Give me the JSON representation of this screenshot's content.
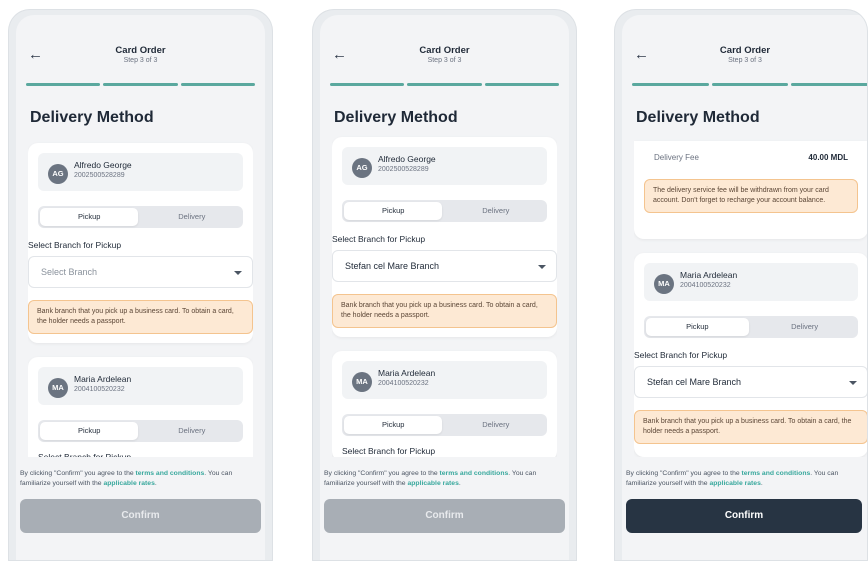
{
  "screens": [
    {
      "header": {
        "back_icon": "arrow-left-icon",
        "title": "Card Order",
        "step": "Step 3 of 3"
      },
      "section_title": "Delivery Method",
      "cards": [
        {
          "avatar": "AG",
          "name": "Alfredo George",
          "id": "2002500528289",
          "toggle": {
            "left": "Pickup",
            "right": "Delivery",
            "selected": "Pickup"
          },
          "branch_label": "Select Branch for Pickup",
          "select_value": "Select Branch",
          "note": "Bank branch that you pick up a business card. To obtain a card, the holder needs a passport."
        },
        {
          "avatar": "MA",
          "name": "Maria Ardelean",
          "id": "2004100520232",
          "toggle": {
            "left": "Pickup",
            "right": "Delivery",
            "selected": "Pickup"
          },
          "branch_label": "Select Branch for Pickup"
        }
      ],
      "terms": {
        "prefix": "By clicking \"Confirm\" you agree to the ",
        "link1": "terms and conditions",
        "mid": ". You can familiarize yourself with the ",
        "link2": "applicable rates",
        "suffix": "."
      },
      "confirm_label": "Confirm",
      "confirm_enabled": false
    },
    {
      "header": {
        "back_icon": "arrow-left-icon",
        "title": "Card Order",
        "step": "Step 3 of 3"
      },
      "section_title": "Delivery Method",
      "cards": [
        {
          "avatar": "AG",
          "name": "Alfredo George",
          "id": "2002500528289",
          "toggle": {
            "left": "Pickup",
            "right": "Delivery",
            "selected": "Pickup"
          },
          "branch_label": "Select Branch for Pickup",
          "select_value": "Stefan cel Mare Branch",
          "note": "Bank branch that you pick up a business card. To obtain a card, the holder needs a passport."
        },
        {
          "avatar": "MA",
          "name": "Maria Ardelean",
          "id": "2004100520232",
          "toggle": {
            "left": "Pickup",
            "right": "Delivery",
            "selected": "Pickup"
          },
          "branch_label": "Select Branch for Pickup"
        }
      ],
      "terms": {
        "prefix": "By clicking \"Confirm\" you agree to the ",
        "link1": "terms and conditions",
        "mid": ". You can familiarize yourself with the ",
        "link2": "applicable rates",
        "suffix": "."
      },
      "confirm_label": "Confirm",
      "confirm_enabled": false
    },
    {
      "header": {
        "back_icon": "arrow-left-icon",
        "title": "Card Order",
        "step": "Step 3 of 3"
      },
      "section_title": "Delivery Method",
      "fee": {
        "label": "Delivery Fee",
        "value": "40.00 MDL"
      },
      "fee_note": "The delivery service fee will be withdrawn from your card account. Don't forget to recharge your account balance.",
      "cards": [
        {
          "avatar": "MA",
          "name": "Maria Ardelean",
          "id": "2004100520232",
          "toggle": {
            "left": "Pickup",
            "right": "Delivery",
            "selected": "Pickup"
          },
          "branch_label": "Select Branch for Pickup",
          "select_value": "Stefan cel Mare Branch",
          "note": "Bank branch that you pick up a business card. To obtain a card, the holder needs a passport."
        }
      ],
      "terms": {
        "prefix": "By clicking \"Confirm\" you agree to the ",
        "link1": "terms and conditions",
        "mid": ". You can familiarize yourself with the ",
        "link2": "applicable rates",
        "suffix": "."
      },
      "confirm_label": "Confirm",
      "confirm_enabled": true
    }
  ],
  "colors": {
    "accent": "#5aa89e",
    "link": "#38a89d",
    "note_bg": "#fde9d4",
    "note_border": "#f4c48f",
    "confirm_disabled": "#a8aeb5",
    "confirm_enabled": "#273443"
  }
}
